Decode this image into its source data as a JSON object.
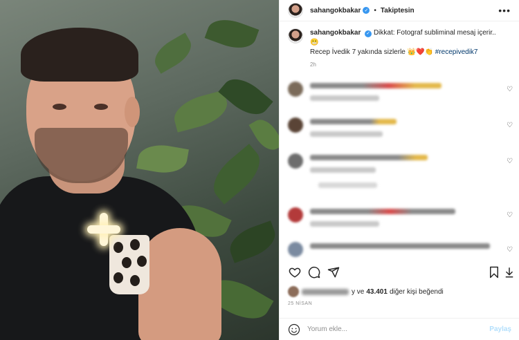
{
  "post": {
    "username": "sahangokbakar",
    "follow_state": "Takiptesin",
    "separator": "•",
    "more": "•••",
    "caption_lead": "Dikkat: Fotograf subliminal mesaj içerir..",
    "caption_line2": "Recep İvedik 7 yakında sizlerle",
    "hashtag": "#recepivedik7",
    "time_ago": "2h"
  },
  "likes": {
    "and_text": "y ve",
    "count": "43.401",
    "others_text": "diğer kişi beğendi"
  },
  "date": "25 NİSAN",
  "compose": {
    "placeholder": "Yorum ekle...",
    "post_label": "Paylaş"
  },
  "icons": {
    "verified": "verified-badge-icon",
    "like": "heart-outline-icon",
    "comment": "comment-bubble-icon",
    "share": "paper-plane-icon",
    "save": "bookmark-icon",
    "emoji": "smiley-icon",
    "more": "ellipsis-icon"
  },
  "colors": {
    "verified": "#3897f0",
    "hashtag": "#00376b",
    "muted": "#8e8e8e",
    "post_button_disabled": "#b2dffc"
  }
}
